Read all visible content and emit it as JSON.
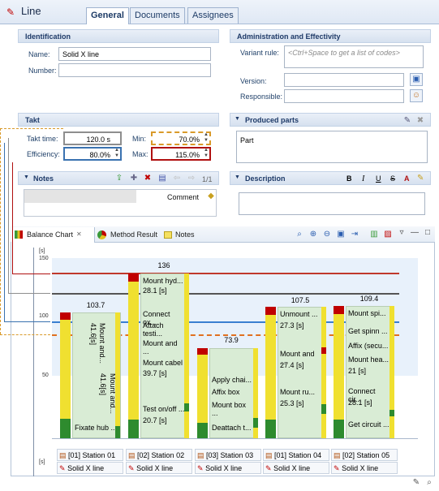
{
  "header": {
    "title": "Line",
    "tabs": [
      "General",
      "Documents",
      "Assignees"
    ]
  },
  "identification": {
    "title": "Identification",
    "name_label": "Name:",
    "name_value": "Solid X line",
    "number_label": "Number:",
    "number_value": ""
  },
  "admin": {
    "title": "Administration and Effectivity",
    "variant_label": "Variant rule:",
    "variant_placeholder": "<Ctrl+Space to get a list of codes>",
    "version_label": "Version:",
    "responsible_label": "Responsible:"
  },
  "takt": {
    "title": "Takt",
    "takt_label": "Takt time:",
    "takt_value": "120.0 s",
    "min_label": "Min:",
    "min_value": "70.0%",
    "eff_label": "Efficiency:",
    "eff_value": "80.0%",
    "max_label": "Max:",
    "max_value": "115.0%"
  },
  "produced": {
    "title": "Produced parts",
    "item": "Part"
  },
  "notes": {
    "title": "Notes",
    "page": "1/1",
    "column": "Comment"
  },
  "description": {
    "title": "Description"
  },
  "chart_tabs": [
    "Balance Chart",
    "Method Result",
    "Notes"
  ],
  "chart_data": {
    "type": "bar",
    "unit_label": "[s]",
    "y_ticks": [
      "150",
      "100",
      "50"
    ],
    "top_label": "136",
    "stations": [
      {
        "name": "[01] Station 01",
        "line": "Solid X line",
        "value": "103.7"
      },
      {
        "name": "[02] Station 02",
        "line": "Solid X line",
        "value": ""
      },
      {
        "name": "[03] Station 03",
        "line": "Solid X line",
        "value": "73.9"
      },
      {
        "name": "[01] Station 04",
        "line": "Solid X line",
        "value": "107.5"
      },
      {
        "name": "[02] Station 05",
        "line": "Solid X line",
        "value": "109.4"
      }
    ],
    "ops": {
      "s1": [
        "Mount and...",
        "41.6[s]",
        "Mount and...",
        "41.6[s]",
        "Fixate hub ..."
      ],
      "s2": [
        "Mount hyd...",
        "28.1 [s]",
        "Connect ox...",
        "Attach testi...",
        "Mount and ...",
        "Mount cabel",
        "39.7 [s]",
        "Test on/off ...",
        "20.7 [s]"
      ],
      "s3": [
        "Apply chai...",
        "Affix box",
        "Mount box ...",
        "Deattach t..."
      ],
      "s4": [
        "Unmount ...",
        "27.3 [s]",
        "Mount and ...",
        "27.4 [s]",
        "Mount ru...",
        "25.3 [s]"
      ],
      "s5": [
        "Mount spi...",
        "Get spinn ...",
        "Affix (secu...",
        "Mount hea...",
        "21 [s]",
        "Connect cir...",
        "28.1 [s]",
        "Get circuit ..."
      ]
    }
  },
  "colors": {
    "accent": "#1e3a68",
    "red": "#c00000",
    "orange": "#e0a030",
    "blue": "#3a7fd0",
    "op_fill": "#d9ecd5"
  }
}
